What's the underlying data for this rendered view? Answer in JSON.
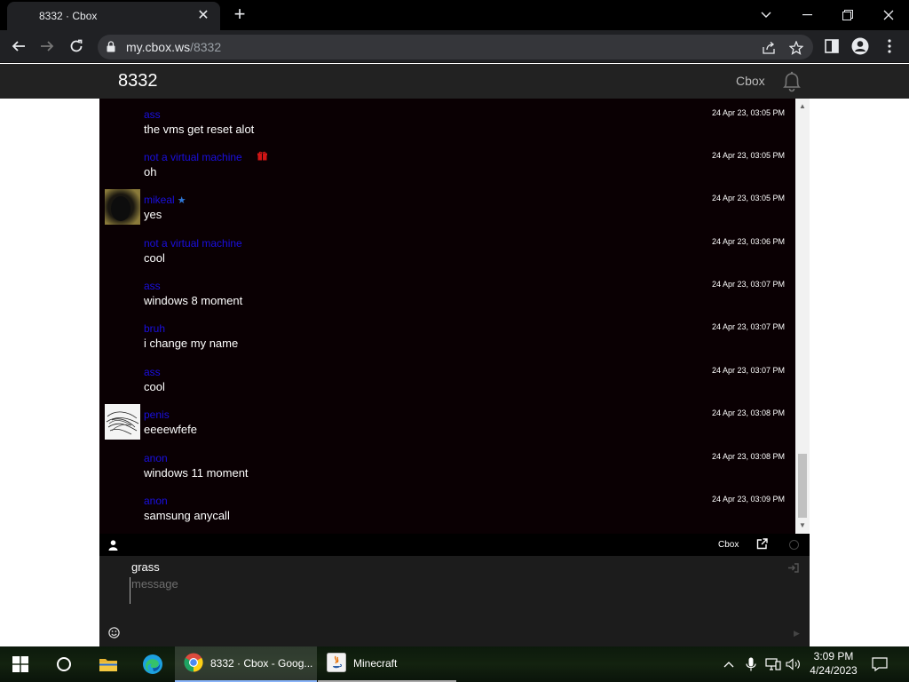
{
  "browser": {
    "tab_title": "8332 · Cbox",
    "url_host": "my.cbox.ws",
    "url_path": "/8332"
  },
  "cbox": {
    "box_title": "8332",
    "brand": "Cbox",
    "messages": [
      {
        "name": "ass",
        "text": "the vms get reset alot",
        "time": "24 Apr 23, 03:05 PM",
        "avatar": "none"
      },
      {
        "name": "not a virtual machine",
        "text": "oh",
        "time": "24 Apr 23, 03:05 PM",
        "avatar": "none",
        "badge": "gift-icon"
      },
      {
        "name": "mikeal",
        "text": "yes",
        "time": "24 Apr 23, 03:05 PM",
        "avatar": "dark-photo",
        "badge": "star-icon"
      },
      {
        "name": "not a virtual machine",
        "text": "cool",
        "time": "24 Apr 23, 03:06 PM",
        "avatar": "none"
      },
      {
        "name": "ass",
        "text": "windows 8 moment",
        "time": "24 Apr 23, 03:07 PM",
        "avatar": "none"
      },
      {
        "name": "bruh",
        "text": "i change my name",
        "time": "24 Apr 23, 03:07 PM",
        "avatar": "none"
      },
      {
        "name": "ass",
        "text": "cool",
        "time": "24 Apr 23, 03:07 PM",
        "avatar": "none"
      },
      {
        "name": "penis",
        "text": "eeeewfefe",
        "time": "24 Apr 23, 03:08 PM",
        "avatar": "scribble"
      },
      {
        "name": "anon",
        "text": "windows 11 moment",
        "time": "24 Apr 23, 03:08 PM",
        "avatar": "none"
      },
      {
        "name": "anon",
        "text": "samsung anycall",
        "time": "24 Apr 23, 03:09 PM",
        "avatar": "none"
      }
    ],
    "chatbar_brand": "Cbox",
    "username": "grass",
    "message_placeholder": "message",
    "colors": {
      "name": "#1a0fe0",
      "chat_bg": "#0a0003",
      "gift": "#d01515",
      "star": "#2f78d8"
    }
  },
  "taskbar": {
    "apps": [
      {
        "label": "8332 · Cbox - Goog...",
        "icon": "chrome-icon",
        "state": "active"
      },
      {
        "label": "Minecraft",
        "icon": "java-icon",
        "state": "running"
      }
    ],
    "time": "3:09 PM",
    "date": "4/24/2023"
  }
}
